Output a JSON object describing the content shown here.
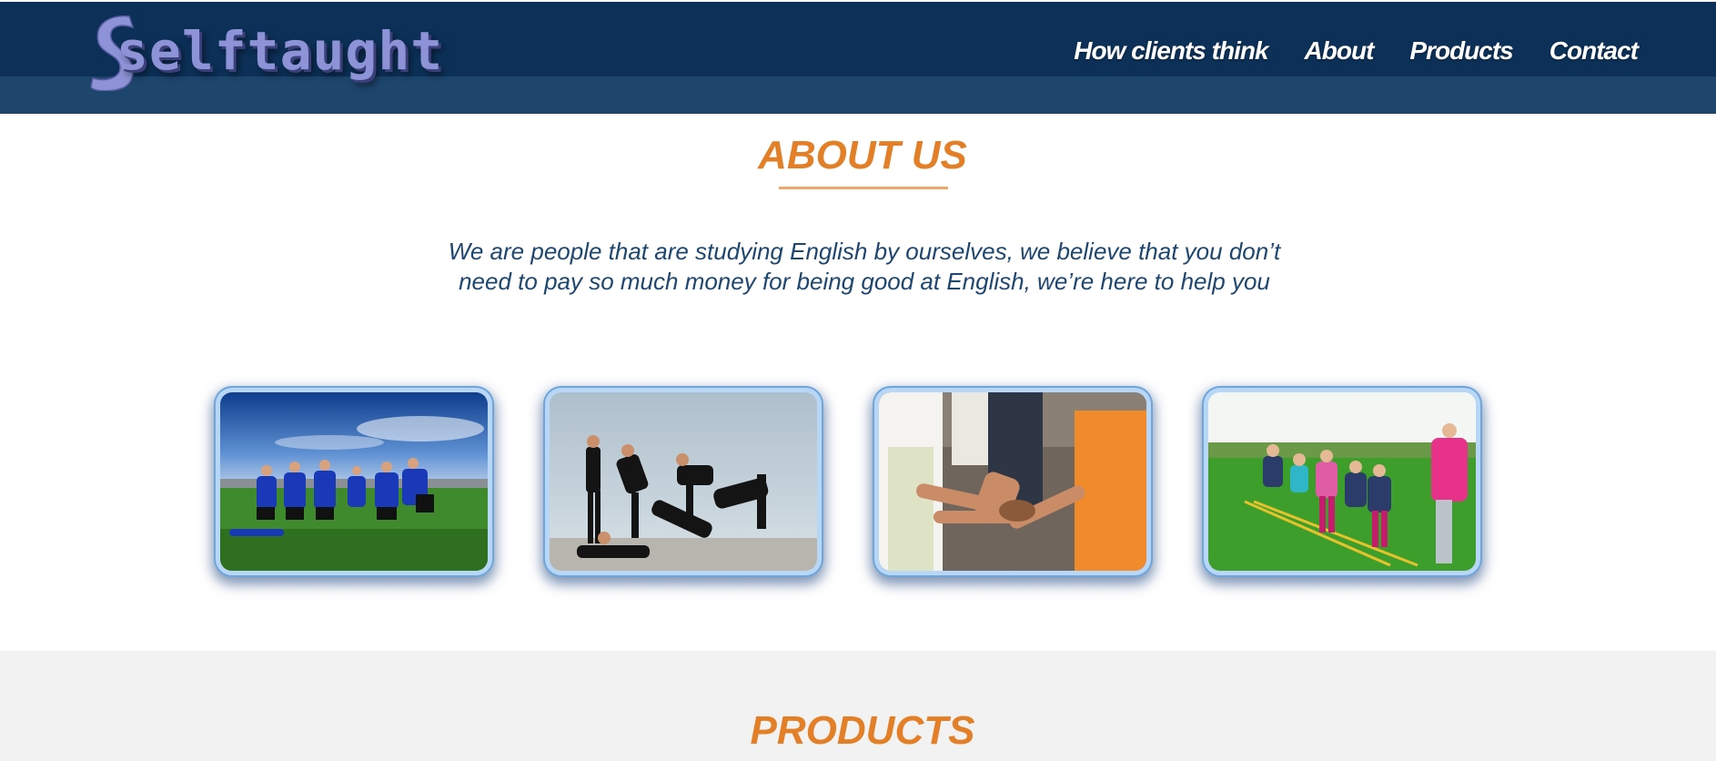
{
  "header": {
    "logo_text": "selftaught",
    "nav": [
      "How clients think",
      "About",
      "Products",
      "Contact"
    ]
  },
  "about": {
    "title": "ABOUT US",
    "description": "We are people that are studying English by ourselves, we believe that you don’t need to pay so much money for being good at English, we’re here to help you",
    "photos": [
      "soccer-team-photo",
      "dancers-photo",
      "hands-together-photo",
      "kids-playing-photo"
    ]
  },
  "products": {
    "title": "PRODUCTS"
  },
  "colors": {
    "header": "#0c3057",
    "accent": "#e27f27",
    "text": "#1d4670",
    "photo_border": "#b8d6f5"
  }
}
